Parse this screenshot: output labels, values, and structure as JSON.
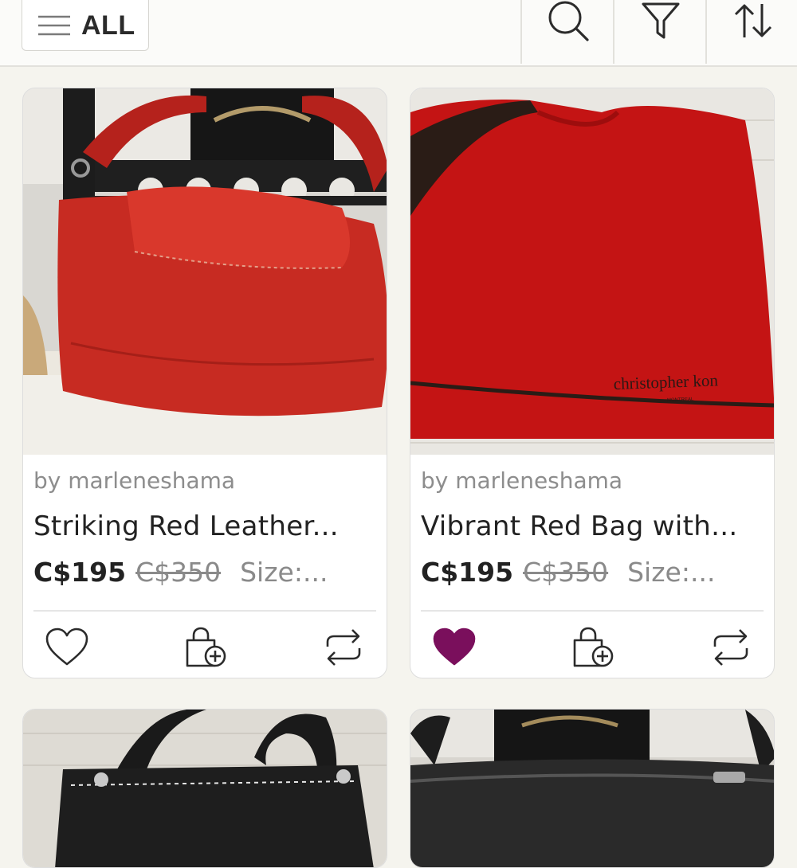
{
  "header": {
    "filter_label": "ALL",
    "icons": [
      "menu-icon",
      "search-icon",
      "filter-icon",
      "sort-icon"
    ]
  },
  "listings": [
    {
      "seller": "by marleneshama",
      "title": "Striking Red Leather...",
      "price": "C$195",
      "original_price": "C$350",
      "size": "Size:...",
      "liked": false,
      "image": "red leather handbag on chair"
    },
    {
      "seller": "by marleneshama",
      "title": "Vibrant Red Bag with...",
      "price": "C$195",
      "original_price": "C$350",
      "size": "Size:...",
      "liked": true,
      "image": "red dust bag",
      "image_text": "christopher kon",
      "image_subtext": "MONTREAL"
    },
    {
      "image": "black bag with white stitching"
    },
    {
      "image": "black leather bag with chair"
    }
  ],
  "colors": {
    "accent_like": "#7a0f5c",
    "background": "#f5f4ee",
    "price_strike": "#8a8a8a"
  }
}
